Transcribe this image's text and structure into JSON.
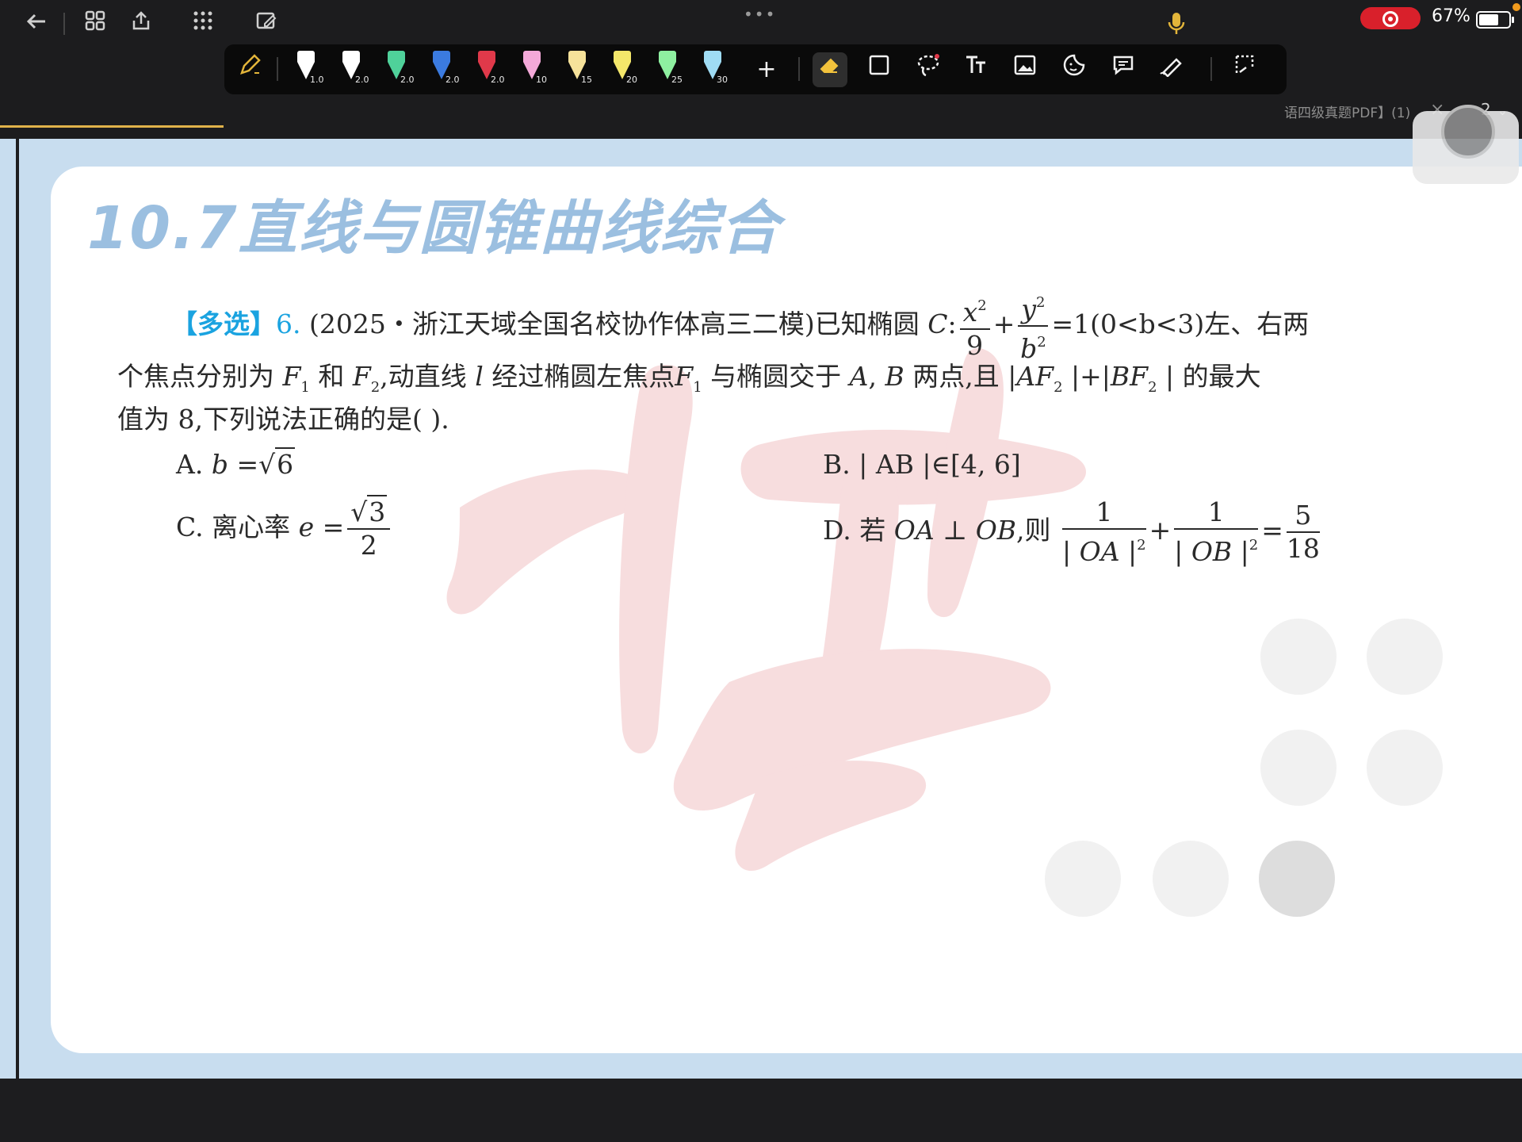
{
  "status_bar": {
    "battery_percent": "67%",
    "icons": [
      "back-arrow-icon",
      "grid-icon",
      "share-icon",
      "apps-icon",
      "edit-icon",
      "microphone-icon",
      "record-icon",
      "battery-icon"
    ]
  },
  "tab": {
    "title": "语四级真题PDF】(1)",
    "close": "×",
    "page": "2"
  },
  "pen_toolbar": {
    "pens": [
      {
        "size": "1.0",
        "color": "#ffffff"
      },
      {
        "size": "2.0",
        "color": "#ffffff"
      },
      {
        "size": "2.0",
        "color": "#4fd19a"
      },
      {
        "size": "2.0",
        "color": "#3b7be0"
      },
      {
        "size": "2.0",
        "color": "#e0394a"
      },
      {
        "size": "10",
        "color": "#f4a9d9"
      },
      {
        "size": "15",
        "color": "#f6e29a"
      },
      {
        "size": "20",
        "color": "#f4e76a"
      },
      {
        "size": "25",
        "color": "#8ef0a0"
      },
      {
        "size": "30",
        "color": "#9fdcf4"
      }
    ],
    "add": "+",
    "tools": [
      "eraser-icon",
      "shape-icon",
      "lasso-icon",
      "text-icon",
      "image-icon",
      "sticker-icon",
      "comment-icon",
      "laser-pointer-icon",
      "crop-icon"
    ]
  },
  "document": {
    "section_title": "10.7直线与圆锥曲线综合",
    "tag": "【多选】",
    "number": "6.",
    "source": "(2025・浙江天域全国名校协作体高三二模)已知椭圆",
    "C": "C",
    "colon": ":",
    "x": "x",
    "y": "y",
    "sq": "2",
    "nine": "9",
    "b": "b",
    "eq_condition": "=1(0<b<3)左、右两",
    "line2_a": "个焦点分别为",
    "F": "F",
    "one": "1",
    "two": "2",
    "and": "和",
    "line2_b": ",动直线",
    "l": "l",
    "line2_c": "经过椭圆左焦点",
    "line2_d": "与椭圆交于",
    "A": "A",
    "B": "B",
    "line2_e": "两点,且 |",
    "AF": "AF",
    "plus_abs": "|+|",
    "BF": "BF",
    "line2_f": "| 的最大",
    "line3": "值为 8,下列说法正确的是(          ).",
    "optA_label": "A.",
    "optA_eq": "=",
    "optA_rad": "6",
    "optB_label": "B.",
    "optB_text": "| AB |∈[4, 6]",
    "optC_label": "C.",
    "optC_text": "离心率",
    "e": "e",
    "optC_eq": "=",
    "optC_rad": "3",
    "optC_den": "2",
    "optD_label": "D.",
    "optD_text1": "若",
    "OA": "OA",
    "perp": "⊥",
    "OB": "OB",
    "optD_text2": ",则",
    "optD_one": "1",
    "abs_OA": "| OA |",
    "abs_OB": "| OB |",
    "optD_plus": "+",
    "optD_eq": "=",
    "optD_num": "5",
    "optD_den": "18"
  }
}
